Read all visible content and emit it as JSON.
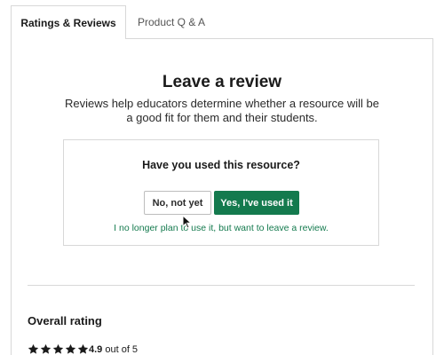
{
  "tabs": [
    {
      "label": "Ratings & Reviews"
    },
    {
      "label": "Product Q & A"
    }
  ],
  "review": {
    "title": "Leave a review",
    "subtitle": "Reviews help educators determine whether a resource will be a good fit for them and their students.",
    "question": "Have you used this resource?",
    "no_label": "No, not yet",
    "yes_label": "Yes, I've used it",
    "alt_link": "I no longer plan to use it, but want to leave a review."
  },
  "overall": {
    "label": "Overall rating",
    "value": "4.9",
    "suffix": "out of 5",
    "stars": 5
  },
  "colors": {
    "accent": "#147a4e",
    "border": "#d8d8d8"
  },
  "icons": {
    "star": "star-icon",
    "cursor": "mouse-pointer-icon"
  }
}
